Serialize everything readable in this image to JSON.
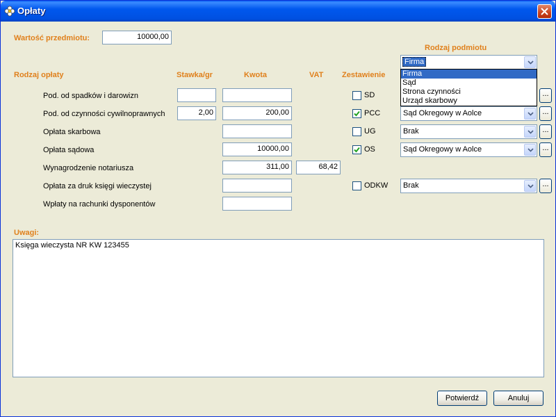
{
  "window": {
    "title": "Opłaty"
  },
  "subject_value": {
    "label": "Wartość przedmiotu:",
    "value": "10000,00"
  },
  "headers": {
    "rodzaj_oplaty": "Rodzaj opłaty",
    "stawka": "Stawka/gr",
    "kwota": "Kwota",
    "vat": "VAT",
    "zestawienie": "Zestawienie",
    "rodzaj_podmiotu": "Rodzaj podmiotu"
  },
  "top_combo": {
    "selected": "Firma"
  },
  "dropdown_options": [
    "Firma",
    "Sąd",
    "Strona czynności",
    "Urząd skarbowy"
  ],
  "rows": [
    {
      "label": "Pod. od spadków i darowizn",
      "stawka": "",
      "kwota": "",
      "vat": null,
      "code": "SD",
      "checked": false,
      "podmiot": null
    },
    {
      "label": "Pod. od czynności cywilnoprawnych",
      "stawka": "2,00",
      "kwota": "200,00",
      "vat": null,
      "code": "PCC",
      "checked": true,
      "podmiot": "Sąd Okregowy w Aolce"
    },
    {
      "label": "Opłata skarbowa",
      "stawka": null,
      "kwota": "",
      "vat": null,
      "code": "UG",
      "checked": false,
      "podmiot": "Brak"
    },
    {
      "label": "Opłata sądowa",
      "stawka": null,
      "kwota": "10000,00",
      "vat": null,
      "code": "OS",
      "checked": true,
      "podmiot": "Sąd Okregowy w Aolce"
    },
    {
      "label": "Wynagrodzenie notariusza",
      "stawka": null,
      "kwota": "311,00",
      "vat": "68,42",
      "code": null,
      "checked": null,
      "podmiot": null
    },
    {
      "label": "Opłata za druk księgi wieczystej",
      "stawka": null,
      "kwota": "",
      "vat": null,
      "code": "ODKW",
      "checked": false,
      "podmiot": "Brak"
    },
    {
      "label": "Wpłaty na rachunki dysponentów",
      "stawka": null,
      "kwota": "",
      "vat": null,
      "code": null,
      "checked": null,
      "podmiot": null
    }
  ],
  "notes": {
    "label": "Uwagi:",
    "text": "Księga wieczysta NR KW 123455"
  },
  "buttons": {
    "confirm": "Potwierdź",
    "cancel": "Anuluj",
    "browse": "..."
  }
}
